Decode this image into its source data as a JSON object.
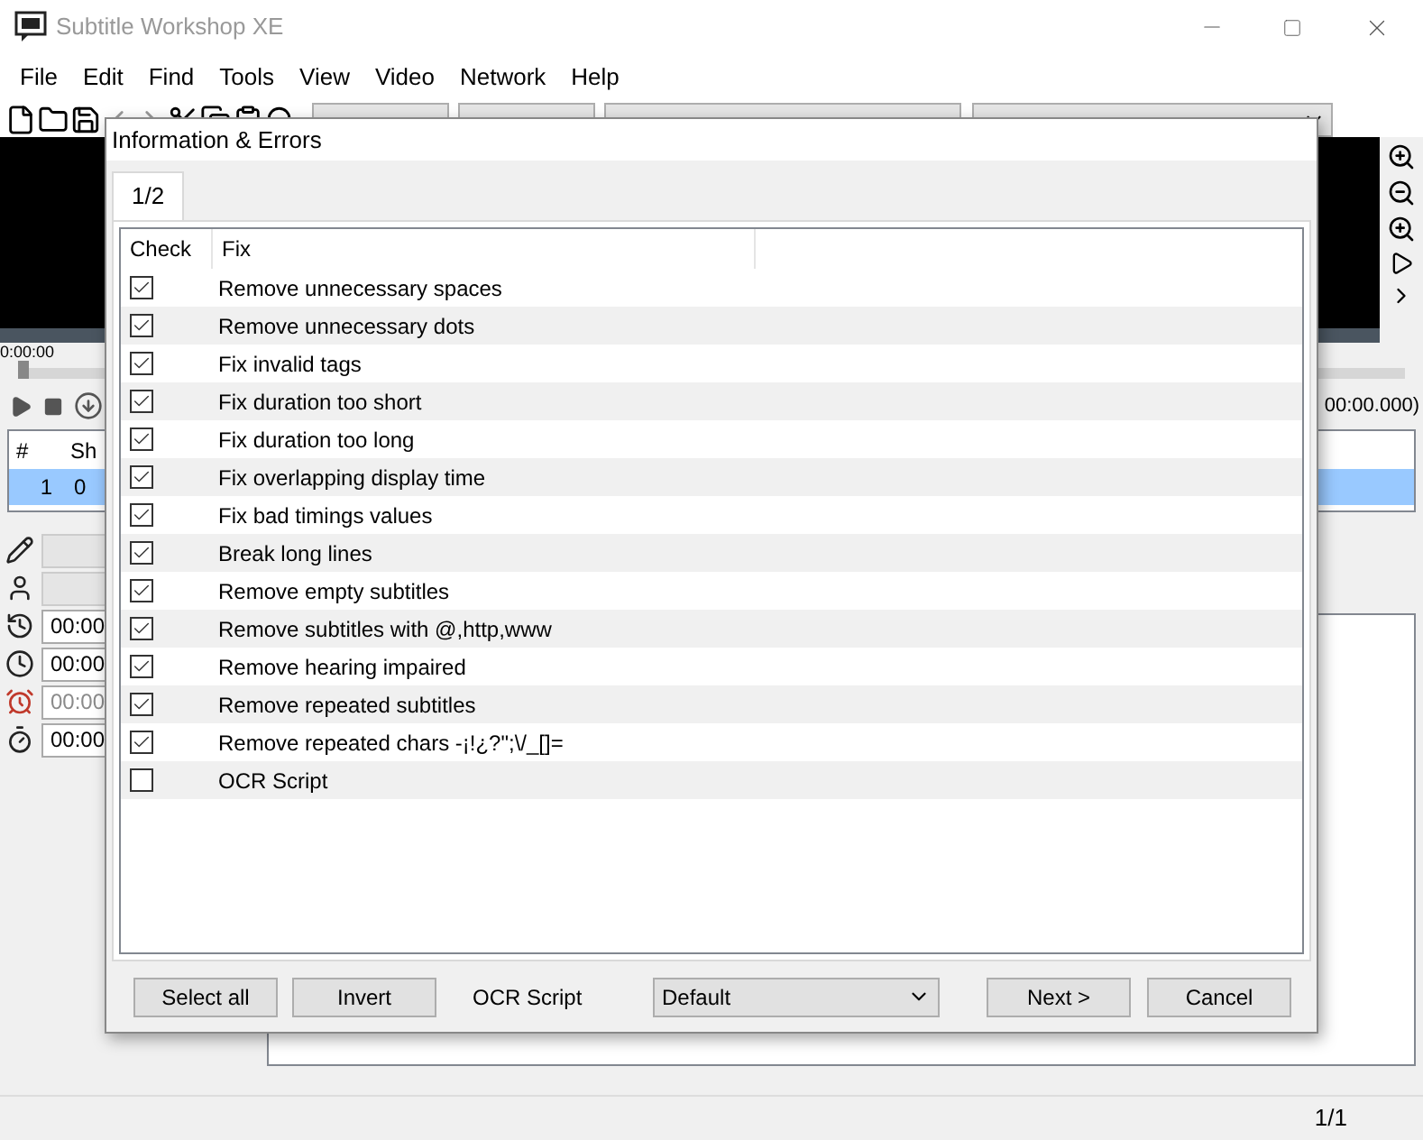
{
  "app": {
    "title": "Subtitle Workshop XE"
  },
  "menu": [
    "File",
    "Edit",
    "Find",
    "Tools",
    "View",
    "Video",
    "Network",
    "Help"
  ],
  "player": {
    "time": "0:00:00",
    "position_reading": "00:00.000)",
    "level": 0
  },
  "subtitle_grid": {
    "columns": [
      "#",
      "Sh"
    ],
    "rows": [
      {
        "cells": [
          "1",
          "0"
        ],
        "selected": true
      }
    ]
  },
  "edit_fields": [
    {
      "kind": "text"
    },
    {
      "kind": "actor"
    },
    {
      "kind": "show",
      "value": "00:00",
      "disabled": false
    },
    {
      "kind": "hide",
      "value": "00:00",
      "disabled": false
    },
    {
      "kind": "duration",
      "value": "00:00",
      "disabled": true
    },
    {
      "kind": "pause",
      "value": "00:00",
      "disabled": false
    }
  ],
  "dialog": {
    "title": "Information & Errors",
    "tabs": [
      {
        "label": "1/2",
        "selected": true
      }
    ],
    "columns": [
      "Check",
      "Fix"
    ],
    "fixes": [
      {
        "label": "Remove unnecessary spaces",
        "checked": true
      },
      {
        "label": "Remove unnecessary dots",
        "checked": true
      },
      {
        "label": "Fix invalid tags",
        "checked": true
      },
      {
        "label": "Fix duration too short",
        "checked": true
      },
      {
        "label": "Fix duration too long",
        "checked": true
      },
      {
        "label": "Fix overlapping display time",
        "checked": true
      },
      {
        "label": "Fix bad timings values",
        "checked": true
      },
      {
        "label": "Break long lines",
        "checked": true
      },
      {
        "label": "Remove empty subtitles",
        "checked": true
      },
      {
        "label": "Remove subtitles with @,http,www",
        "checked": true
      },
      {
        "label": "Remove hearing impaired",
        "checked": true
      },
      {
        "label": "Remove repeated subtitles",
        "checked": true
      },
      {
        "label": "Remove repeated chars -¡!¿?\";\\/_[]=",
        "checked": true
      },
      {
        "label": "OCR Script",
        "checked": false
      }
    ],
    "buttons_left": [
      "Select all",
      "Invert"
    ],
    "script_label": "OCR Script",
    "script_select": {
      "value": "Default"
    },
    "buttons_right": [
      "Next >",
      "Cancel"
    ]
  },
  "status_bar": {
    "page": "1/1"
  }
}
